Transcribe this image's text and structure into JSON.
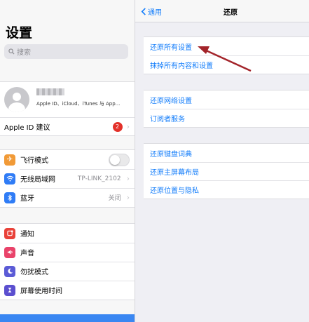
{
  "sidebar": {
    "title": "设置",
    "search_placeholder": "搜索",
    "profile": {
      "subtitle": "Apple ID、iCloud、iTunes 与 App...",
      "suggestion_label": "Apple ID 建议",
      "suggestion_badge": "2"
    },
    "connectivity": [
      {
        "label": "飞行模式",
        "icon": "airplane-icon",
        "color": "#f19a37"
      },
      {
        "label": "无线局域网",
        "value": "TP-LINK_2102",
        "icon": "wifi-icon",
        "color": "#2f7cf6"
      },
      {
        "label": "蓝牙",
        "value": "关闭",
        "icon": "bluetooth-icon",
        "color": "#2f7cf6"
      }
    ],
    "notifications": [
      {
        "label": "通知",
        "icon": "notifications-icon",
        "color": "#e9423a"
      },
      {
        "label": "声音",
        "icon": "sound-icon",
        "color": "#e9436a"
      },
      {
        "label": "勿扰模式",
        "icon": "moon-icon",
        "color": "#5b5bd6"
      },
      {
        "label": "屏幕使用时间",
        "icon": "hourglass-icon",
        "color": "#5b4fcf"
      }
    ]
  },
  "detail": {
    "back_label": "通用",
    "title": "还原",
    "group1": [
      "还原所有设置",
      "抹掉所有内容和设置"
    ],
    "group2": [
      "还原网络设置",
      "订阅者服务"
    ],
    "group3": [
      "还原键盘词典",
      "还原主屏幕布局",
      "还原位置与隐私"
    ]
  },
  "colors": {
    "link": "#147efb",
    "annotation_arrow": "#a3242a",
    "selection": "#3a87f2"
  }
}
